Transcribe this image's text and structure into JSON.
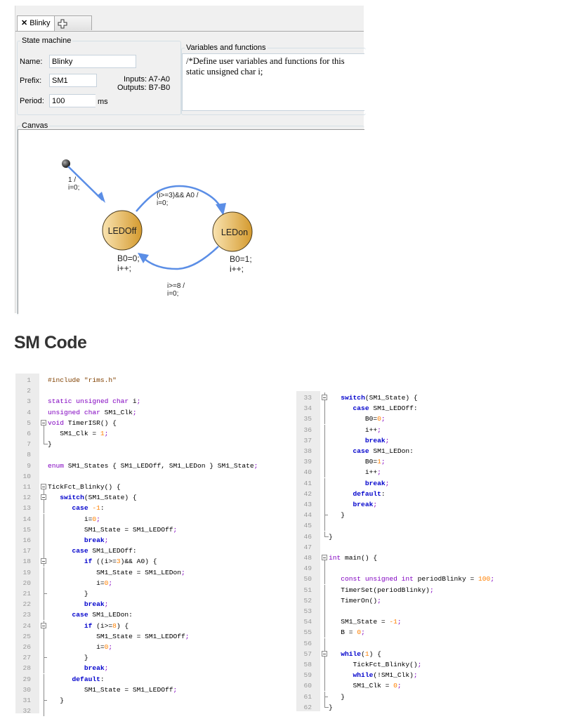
{
  "tabs": [
    {
      "label": "Blinky",
      "close_icon": "close-icon"
    },
    {
      "label": "",
      "icon": "add-tab-icon"
    }
  ],
  "state_machine": {
    "legend": "State machine",
    "name_label": "Name:",
    "name_value": "Blinky",
    "prefix_label": "Prefix:",
    "prefix_value": "SM1",
    "period_label": "Period:",
    "period_value": "100",
    "period_unit": "ms",
    "inputs": "Inputs: A7-A0",
    "outputs": "Outputs: B7-B0"
  },
  "variables": {
    "legend": "Variables and functions",
    "text": "/*Define user variables and functions for this\nstatic unsigned char i;"
  },
  "canvas": {
    "legend": "Canvas",
    "initial_transition": {
      "line1": "1 /",
      "line2": "i=0;"
    },
    "states": [
      {
        "name": "LEDOff",
        "action1": "B0=0;",
        "action2": "i++;"
      },
      {
        "name": "LEDon",
        "action1": "B0=1;",
        "action2": "i++;"
      }
    ],
    "transitions": [
      {
        "from": "LEDOff",
        "to": "LEDon",
        "line1": "(i>=3)&& A0 /",
        "line2": "i=0;"
      },
      {
        "from": "LEDon",
        "to": "LEDOff",
        "line1": "i>=8 /",
        "line2": "i=0;"
      }
    ],
    "colors": {
      "state_fill_light": "#f7dfa8",
      "state_fill_dark": "#d9a13a",
      "arrow": "#5b8ee6"
    }
  },
  "heading": "SM Code",
  "code": {
    "left": [
      {
        "n": "1",
        "html": "<span class='s'>#include \"rims.h\"</span>"
      },
      {
        "n": "2",
        "html": ""
      },
      {
        "n": "3",
        "html": "<span class='t'>static unsigned char</span> i<span class='p'>;</span>"
      },
      {
        "n": "4",
        "html": "<span class='t'>unsigned char</span> SM1_Clk<span class='p'>;</span>"
      },
      {
        "n": "5",
        "fold": "start",
        "html": "<span class='t'>void</span> TimerISR() {"
      },
      {
        "n": "6",
        "fold": "mid",
        "html": "   SM1_Clk = <span class='n'>1</span><span class='p'>;</span>"
      },
      {
        "n": "7",
        "fold": "end",
        "html": "}"
      },
      {
        "n": "8",
        "html": ""
      },
      {
        "n": "9",
        "html": "<span class='t'>enum</span> SM1_States { SM1_LEDOff, SM1_LEDon } SM1_State<span class='p'>;</span>"
      },
      {
        "n": "10",
        "html": ""
      },
      {
        "n": "11",
        "fold": "start",
        "html": "TickFct_Blinky() {"
      },
      {
        "n": "12",
        "fold": "startmid",
        "html": "   <span class='k'>switch</span>(SM1_State) {"
      },
      {
        "n": "13",
        "fold": "mid",
        "html": "      <span class='k'>case</span> <span class='n'>-1</span>:"
      },
      {
        "n": "14",
        "fold": "mid",
        "html": "         i=<span class='n'>0</span><span class='p'>;</span>"
      },
      {
        "n": "15",
        "fold": "mid",
        "html": "         SM1_State = SM1_LEDOff<span class='p'>;</span>"
      },
      {
        "n": "16",
        "fold": "mid",
        "html": "         <span class='k'>break</span><span class='p'>;</span>"
      },
      {
        "n": "17",
        "fold": "mid",
        "html": "      <span class='k'>case</span> SM1_LEDOff:"
      },
      {
        "n": "18",
        "fold": "startmid",
        "html": "         <span class='k'>if</span> ((i&gt;=<span class='n'>3</span>)&amp;&amp; A0) {"
      },
      {
        "n": "19",
        "fold": "mid",
        "html": "            SM1_State = SM1_LEDon<span class='p'>;</span>"
      },
      {
        "n": "20",
        "fold": "mid",
        "html": "            i=<span class='n'>0</span><span class='p'>;</span>"
      },
      {
        "n": "21",
        "fold": "tick",
        "html": "         }"
      },
      {
        "n": "22",
        "fold": "mid",
        "html": "         <span class='k'>break</span><span class='p'>;</span>"
      },
      {
        "n": "23",
        "fold": "mid",
        "html": "      <span class='k'>case</span> SM1_LEDon:"
      },
      {
        "n": "24",
        "fold": "startmid",
        "html": "         <span class='k'>if</span> (i&gt;=<span class='n'>8</span>) {"
      },
      {
        "n": "25",
        "fold": "mid",
        "html": "            SM1_State = SM1_LEDOff<span class='p'>;</span>"
      },
      {
        "n": "26",
        "fold": "mid",
        "html": "            i=<span class='n'>0</span><span class='p'>;</span>"
      },
      {
        "n": "27",
        "fold": "tick",
        "html": "         }"
      },
      {
        "n": "28",
        "fold": "mid",
        "html": "         <span class='k'>break</span><span class='p'>;</span>"
      },
      {
        "n": "29",
        "fold": "mid",
        "html": "      <span class='k'>default</span>:"
      },
      {
        "n": "30",
        "fold": "mid",
        "html": "         SM1_State = SM1_LEDOff<span class='p'>;</span>"
      },
      {
        "n": "31",
        "fold": "tick",
        "html": "   }"
      },
      {
        "n": "32",
        "fold": "mid",
        "html": ""
      }
    ],
    "right": [
      {
        "n": "33",
        "fold": "startmid",
        "html": "   <span class='k'>switch</span>(SM1_State) {"
      },
      {
        "n": "34",
        "fold": "mid",
        "html": "      <span class='k'>case</span> SM1_LEDOff:"
      },
      {
        "n": "35",
        "fold": "mid",
        "html": "         B0=<span class='n'>0</span><span class='p'>;</span>"
      },
      {
        "n": "36",
        "fold": "mid",
        "html": "         i++<span class='p'>;</span>"
      },
      {
        "n": "37",
        "fold": "mid",
        "html": "         <span class='k'>break</span><span class='p'>;</span>"
      },
      {
        "n": "38",
        "fold": "mid",
        "html": "      <span class='k'>case</span> SM1_LEDon:"
      },
      {
        "n": "39",
        "fold": "mid",
        "html": "         B0=<span class='n'>1</span><span class='p'>;</span>"
      },
      {
        "n": "40",
        "fold": "mid",
        "html": "         i++<span class='p'>;</span>"
      },
      {
        "n": "41",
        "fold": "mid",
        "html": "         <span class='k'>break</span><span class='p'>;</span>"
      },
      {
        "n": "42",
        "fold": "mid",
        "html": "      <span class='k'>default</span>:"
      },
      {
        "n": "43",
        "fold": "mid",
        "html": "      <span class='k'>break</span><span class='p'>;</span>"
      },
      {
        "n": "44",
        "fold": "tick",
        "html": "   }"
      },
      {
        "n": "45",
        "fold": "mid",
        "html": ""
      },
      {
        "n": "46",
        "fold": "end",
        "html": "}"
      },
      {
        "n": "47",
        "html": ""
      },
      {
        "n": "48",
        "fold": "start",
        "html": "<span class='t'>int</span> main() {"
      },
      {
        "n": "49",
        "fold": "mid",
        "html": ""
      },
      {
        "n": "50",
        "fold": "mid",
        "html": "   <span class='t'>const unsigned int</span> periodBlinky = <span class='n'>100</span><span class='p'>;</span>"
      },
      {
        "n": "51",
        "fold": "mid",
        "html": "   TimerSet(periodBlinky)<span class='p'>;</span>"
      },
      {
        "n": "52",
        "fold": "mid",
        "html": "   TimerOn()<span class='p'>;</span>"
      },
      {
        "n": "53",
        "fold": "mid",
        "html": ""
      },
      {
        "n": "54",
        "fold": "mid",
        "html": "   SM1_State = <span class='n'>-1</span><span class='p'>;</span>"
      },
      {
        "n": "55",
        "fold": "mid",
        "html": "   B = <span class='n'>0</span><span class='p'>;</span>"
      },
      {
        "n": "56",
        "fold": "mid",
        "html": ""
      },
      {
        "n": "57",
        "fold": "startmid",
        "html": "   <span class='k'>while</span>(<span class='n'>1</span>) {"
      },
      {
        "n": "58",
        "fold": "mid",
        "html": "      TickFct_Blinky()<span class='p'>;</span>"
      },
      {
        "n": "59",
        "fold": "mid",
        "html": "      <span class='k'>while</span>(!SM1_Clk)<span class='p'>;</span>"
      },
      {
        "n": "60",
        "fold": "mid",
        "html": "      SM1_Clk = <span class='n'>0</span><span class='p'>;</span>"
      },
      {
        "n": "61",
        "fold": "tick",
        "html": "   }"
      },
      {
        "n": "62",
        "fold": "end",
        "html": "}"
      }
    ]
  }
}
